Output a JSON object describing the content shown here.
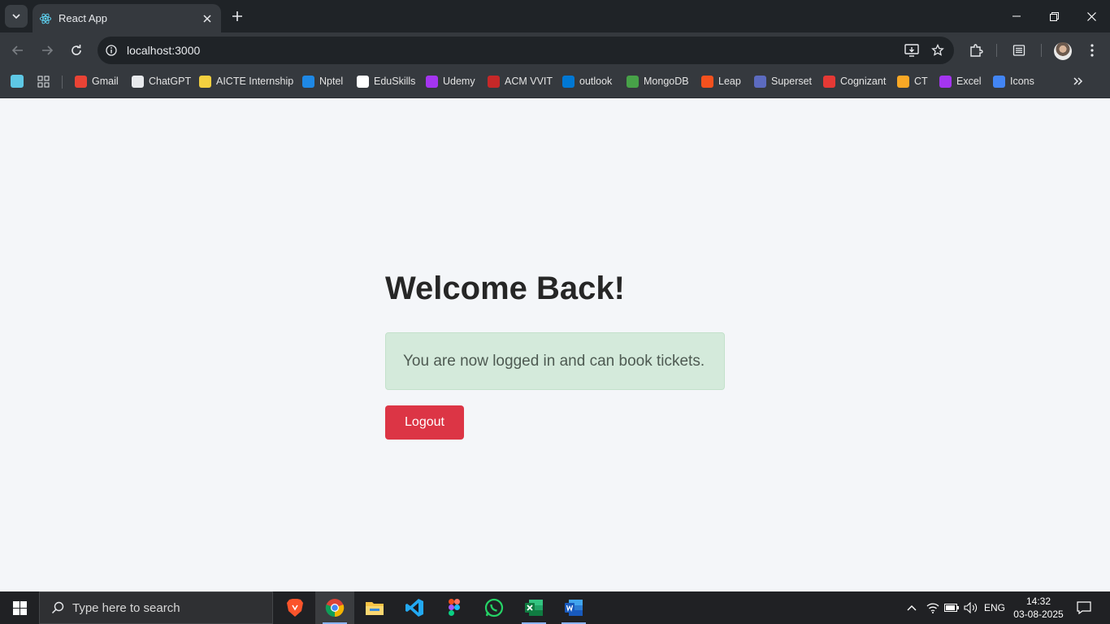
{
  "browser": {
    "tab_title": "React App",
    "url": "localhost:3000",
    "bookmarks": [
      {
        "label": "Gmail",
        "icon": "gmail-icon",
        "color": "#ea4335"
      },
      {
        "label": "ChatGPT",
        "icon": "chatgpt-icon",
        "color": "#e8eaed"
      },
      {
        "label": "AICTE Internship",
        "icon": "aicte-icon",
        "color": "#f4d03f"
      },
      {
        "label": "Nptel",
        "icon": "nptel-icon",
        "color": "#1e88e5"
      },
      {
        "label": "EduSkills",
        "icon": "eduskills-icon",
        "color": "#ffffff"
      },
      {
        "label": "Udemy",
        "icon": "udemy-icon",
        "color": "#a435f0"
      },
      {
        "label": "ACM VVIT",
        "icon": "acm-icon",
        "color": "#c62828"
      },
      {
        "label": "outlook",
        "icon": "outlook-icon",
        "color": "#0078d4"
      },
      {
        "label": "MongoDB",
        "icon": "mongodb-icon",
        "color": "#47a248"
      },
      {
        "label": "Leap",
        "icon": "leap-icon",
        "color": "#f4511e"
      },
      {
        "label": "Superset",
        "icon": "superset-icon",
        "color": "#5c6bc0"
      },
      {
        "label": "Cognizant",
        "icon": "cognizant-icon",
        "color": "#e53935"
      },
      {
        "label": "CT",
        "icon": "ct-icon",
        "color": "#f9a825"
      },
      {
        "label": "Excel",
        "icon": "excel-bookmark-icon",
        "color": "#a435f0"
      },
      {
        "label": "Icons",
        "icon": "folder-icon",
        "color": "#4285f4"
      }
    ]
  },
  "page": {
    "heading": "Welcome Back!",
    "message": "You are now logged in and can book tickets.",
    "logout_label": "Logout"
  },
  "taskbar": {
    "search_placeholder": "Type here to search",
    "language": "ENG",
    "time": "14:32",
    "date": "03-08-2025"
  },
  "colors": {
    "logout_button": "#dc3545",
    "alert_background": "#d4eadb",
    "page_background": "#f4f6f9"
  }
}
